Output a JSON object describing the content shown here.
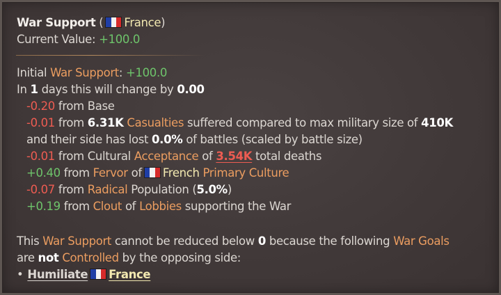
{
  "colors": {
    "background": "#403838",
    "border": "#5e5652",
    "text": "#dcd7d2",
    "highlight_orange": "#eb9d60",
    "positive_green": "#6ec46b",
    "negative_red": "#ee5c52",
    "country_gold": "#f2e8b0",
    "flag_blue": "#1f3ea6",
    "flag_white": "#f2f2f2",
    "flag_red": "#d62a2a"
  },
  "header": {
    "title": "War Support",
    "paren_open": "(",
    "flag_icon": "france-flag-icon",
    "country": "France",
    "paren_close": ")",
    "current_label": "Current Value:",
    "current_value": "+100.0"
  },
  "initial": {
    "prefix": "Initial",
    "link": "War Support",
    "colon": ":",
    "value": "+100.0"
  },
  "change": {
    "prefix": "In",
    "days": "1",
    "middle": "days this will change by",
    "amount": "0.00"
  },
  "modifiers": {
    "base": {
      "value": "-0.20",
      "text": "from Base"
    },
    "casualties": {
      "value": "-0.01",
      "from": "from",
      "amount": "6.31K",
      "link": "Casualties",
      "text": "suffered compared to max military size of",
      "max_size": "410K",
      "line2_a": "and their side has lost",
      "percent": "0.0%",
      "line2_b": "of battles (scaled by battle size)"
    },
    "acceptance": {
      "value": "-0.01",
      "text_a": "from Cultural",
      "link": "Acceptance",
      "of": "of",
      "deaths": "3.54K",
      "text_b": "total deaths"
    },
    "fervor": {
      "value": "+0.40",
      "from": "from",
      "link": "Fervor",
      "of": "of",
      "flag_icon": "france-flag-icon",
      "culture": "French",
      "culture_link": "Primary Culture"
    },
    "radical": {
      "value": "-0.07",
      "from": "from",
      "link": "Radical",
      "text": "Population (",
      "percent": "5.0%",
      "close": ")"
    },
    "clout": {
      "value": "+0.19",
      "from": "from",
      "link": "Clout",
      "of": "of",
      "link2": "Lobbies",
      "text": "supporting the War"
    }
  },
  "footer": {
    "line1_a": "This",
    "link": "War Support",
    "line1_b": "cannot be reduced below",
    "min": "0",
    "line1_c": "because the following",
    "link2": "War Goals",
    "line2_a": "are",
    "not": "not",
    "link3": "Controlled",
    "line2_b": "by the opposing side:",
    "bullet": "•",
    "goal": "Humiliate",
    "flag_icon": "france-flag-icon",
    "target": "France"
  }
}
